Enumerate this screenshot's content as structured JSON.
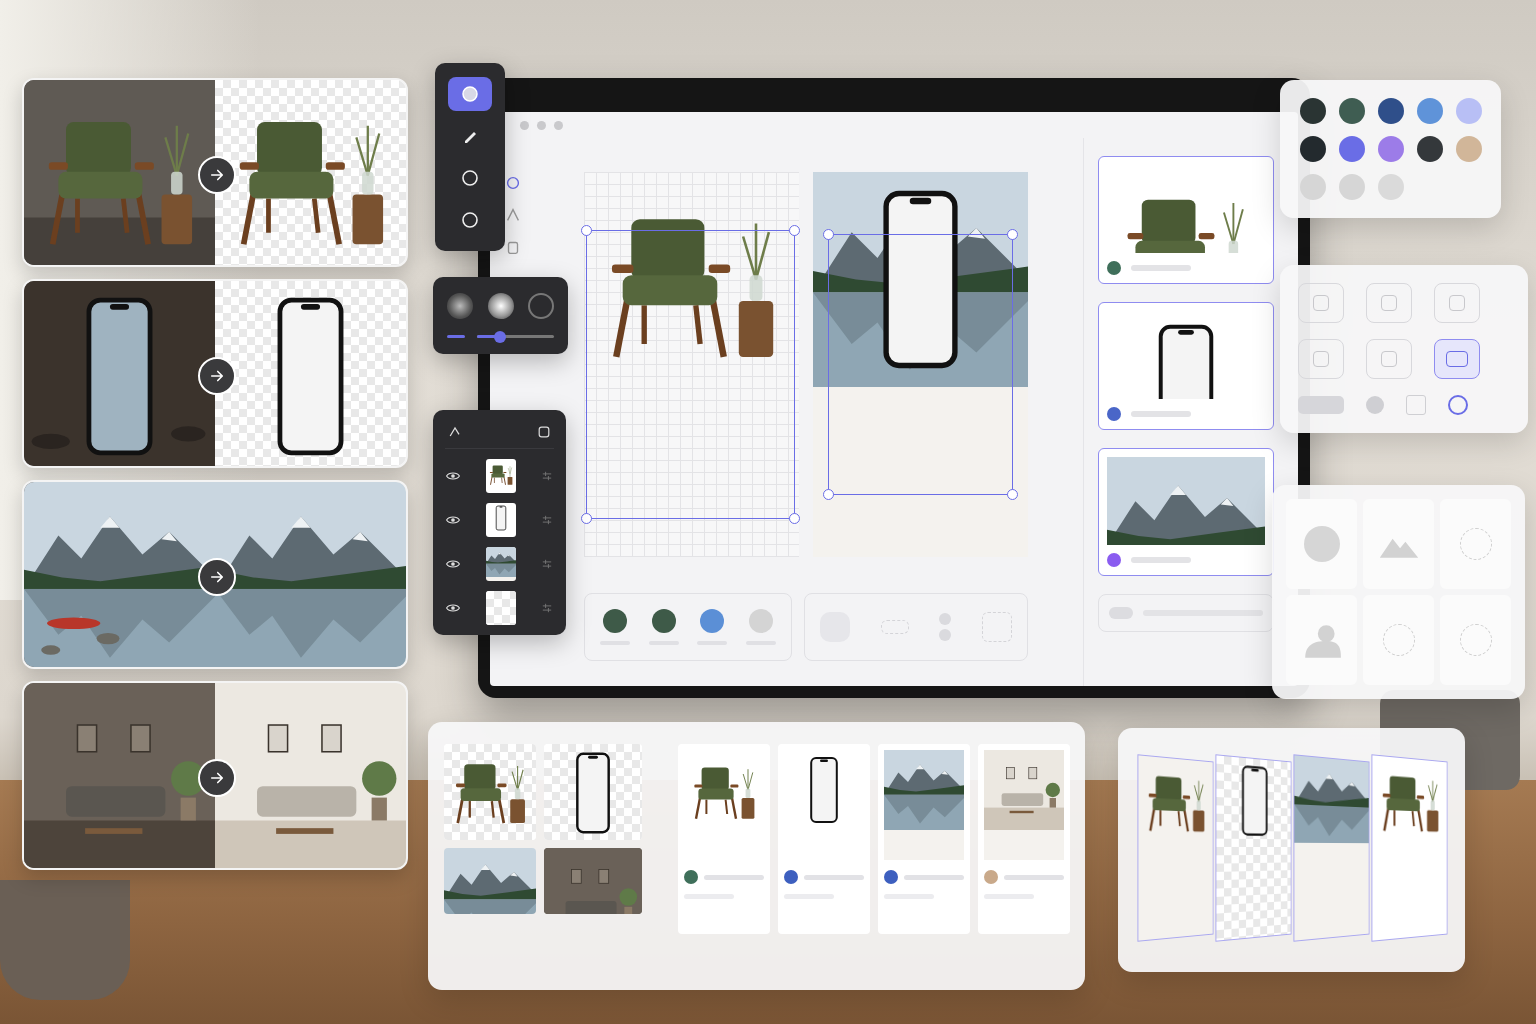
{
  "before_after": [
    {
      "kind": "chair",
      "result": "cut"
    },
    {
      "kind": "phone",
      "result": "cut"
    },
    {
      "kind": "lake",
      "result": "clean"
    },
    {
      "kind": "room",
      "result": "clean"
    }
  ],
  "tools": [
    {
      "kind": "select",
      "selected": true
    },
    {
      "kind": "pen",
      "selected": false
    },
    {
      "kind": "ellipse",
      "selected": false
    },
    {
      "kind": "ellipse",
      "selected": false
    }
  ],
  "brushes": [
    {
      "selected": false
    },
    {
      "selected": true
    },
    {
      "selected": false
    }
  ],
  "brush_size": {
    "level": 0.3
  },
  "layers": [
    {
      "kind": "chair",
      "mode": "plain",
      "visible": true
    },
    {
      "kind": "phone",
      "mode": "plain",
      "visible": true
    },
    {
      "kind": "lake",
      "mode": "clean",
      "visible": true
    },
    {
      "kind": "blank",
      "mode": "cut",
      "visible": true
    }
  ],
  "canvas": {
    "frames": [
      {
        "backdrop": "grid",
        "selected": true,
        "items": [
          {
            "kind": "chair",
            "mode": "bare"
          }
        ]
      },
      {
        "backdrop": "none",
        "selected": true,
        "items": [
          {
            "kind": "lake",
            "mode": "clean"
          },
          {
            "kind": "phone",
            "mode": "bare"
          }
        ]
      }
    ],
    "swatches": [
      "#3e5a48",
      "#3e5a48",
      "#5b8fd6",
      "#d4d4d4"
    ]
  },
  "cards": [
    {
      "kind": "chair",
      "mode": "plain",
      "color": "#3f6f5a",
      "selected": true
    },
    {
      "kind": "phone",
      "mode": "plain",
      "color": "#4a66c8",
      "selected": true
    },
    {
      "kind": "lake",
      "mode": "clean",
      "color": "#8a5cf0",
      "selected": true
    }
  ],
  "palette": [
    "#2a3433",
    "#3f5d52",
    "#2f4f8a",
    "#5f93d9",
    "#b8bff5",
    "#232a2e",
    "#6a6de6",
    "#9c7ce8",
    "#34383b",
    "#d1b699",
    "#d6d6d6",
    "#d6d6d6",
    "#dadada"
  ],
  "shapes": [
    {
      "selected": false
    },
    {
      "selected": false
    },
    {
      "selected": false
    },
    {
      "selected": false
    },
    {
      "selected": false
    },
    {
      "selected": true
    }
  ],
  "batch": {
    "inputs": [
      {
        "kind": "chair",
        "mode": "cut"
      },
      {
        "kind": "phone",
        "mode": "cut"
      },
      {
        "kind": "lake",
        "mode": "clean"
      },
      {
        "kind": "room",
        "mode": "before"
      }
    ],
    "outputs": [
      {
        "kind": "chair",
        "mode": "plain",
        "color": "#3f6f5a"
      },
      {
        "kind": "phone",
        "mode": "plain",
        "color": "#3d5fbf"
      },
      {
        "kind": "lake",
        "mode": "clean",
        "color": "#3d5fbf"
      },
      {
        "kind": "room",
        "mode": "clean",
        "color": "#c9a98a"
      }
    ]
  },
  "stack": [
    {
      "kind": "chair",
      "mode": "clean"
    },
    {
      "kind": "phone",
      "mode": "cut"
    },
    {
      "kind": "lake",
      "mode": "clean"
    },
    {
      "kind": "chair",
      "mode": "plain"
    }
  ]
}
